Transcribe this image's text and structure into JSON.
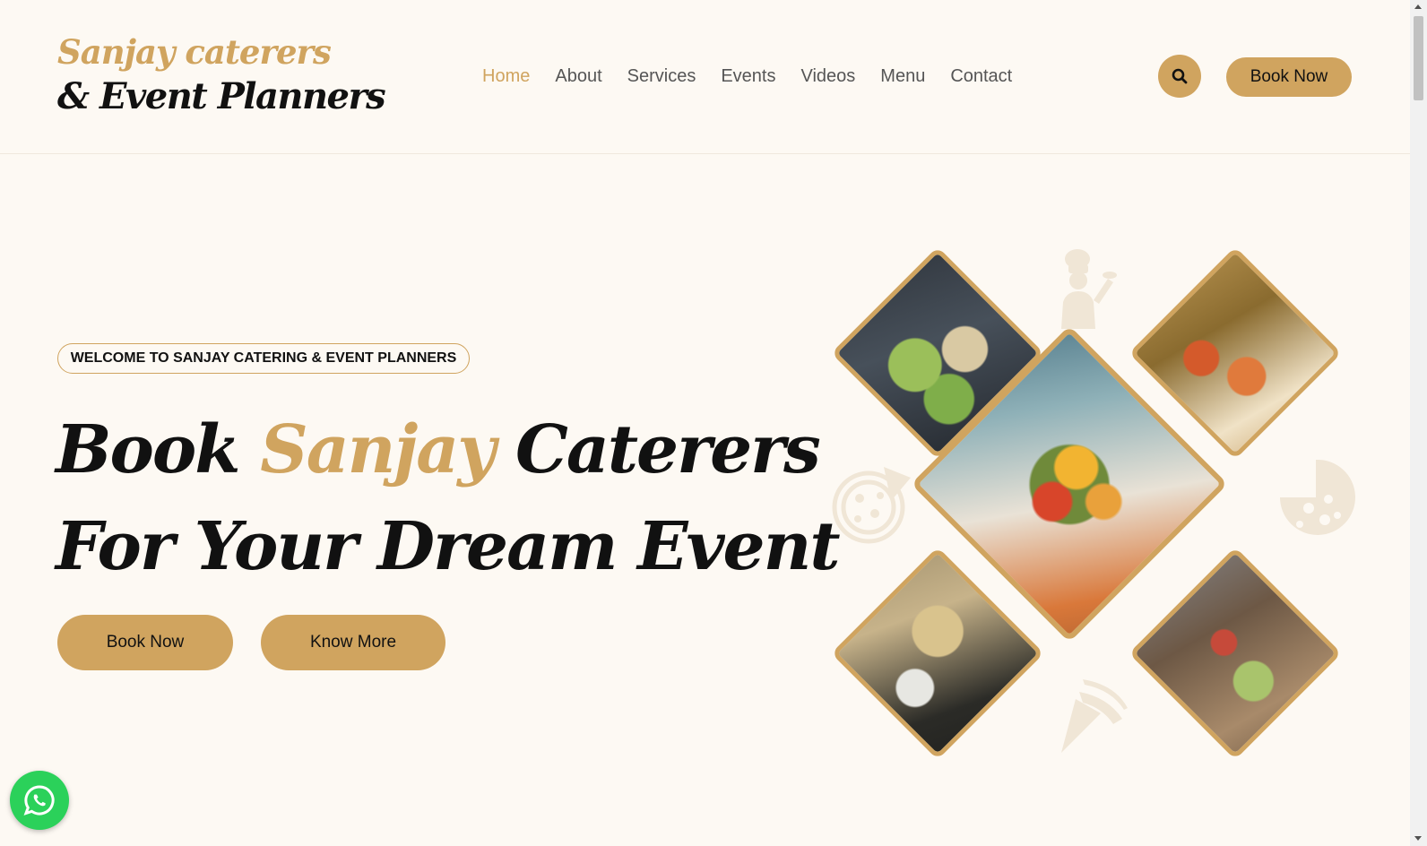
{
  "brand": {
    "line1": "Sanjay caterers",
    "line2": "& Event Planners"
  },
  "nav": {
    "items": [
      "Home",
      "About",
      "Services",
      "Events",
      "Videos",
      "Menu",
      "Contact"
    ],
    "active": "Home"
  },
  "header": {
    "search_icon": "search-icon",
    "book_label": "Book Now"
  },
  "hero": {
    "welcome": "WELCOME TO SANJAY CATERING & EVENT PLANNERS",
    "headline_part1": "Book ",
    "headline_accent": "Sanjay",
    "headline_part2": " Caterers",
    "headline_line2": "For Your Dream Event",
    "book_button": "Book Now",
    "know_button": "Know More"
  },
  "colors": {
    "accent": "#d0a45f",
    "background": "#fdf9f3",
    "whatsapp": "#2bd15a"
  },
  "icons": {
    "whatsapp": "whatsapp-icon",
    "chef": "chef-icon",
    "pizza": "pizza-icon"
  }
}
